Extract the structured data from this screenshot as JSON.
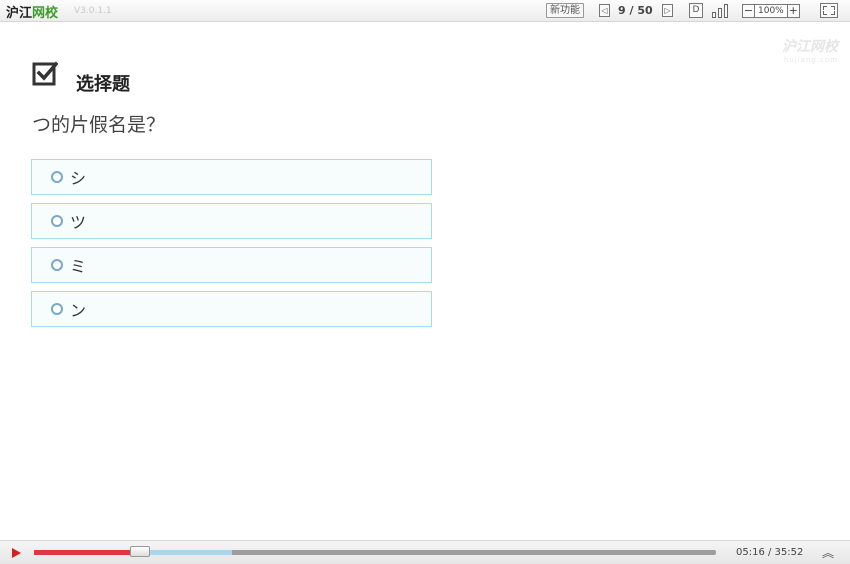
{
  "app": {
    "logo_prefix": "沪江",
    "logo_suffix": "网校",
    "version": "V3.0.1.1"
  },
  "toolbar": {
    "new_features": "新功能",
    "page_counter": "9 / 50",
    "d_label": "D",
    "zoom_minus": "−",
    "zoom_value": "100%",
    "zoom_plus": "+"
  },
  "watermark": {
    "line1": "沪江网校",
    "line2": "hujiang.com"
  },
  "content": {
    "section_title": "选择题",
    "question": "つ的片假名是？",
    "options": [
      {
        "label": "シ"
      },
      {
        "label": "ツ"
      },
      {
        "label": "ミ"
      },
      {
        "label": "ン"
      }
    ]
  },
  "player": {
    "current_time": "05:16",
    "total_time": "35:52",
    "time_display": "05:16 / 35:52",
    "played_fraction": 0.147,
    "buffered_fraction": 0.29
  },
  "colors": {
    "accent_red": "#e0383d",
    "option_border": "#a7dcea",
    "logo_green": "#3c9a2a"
  }
}
